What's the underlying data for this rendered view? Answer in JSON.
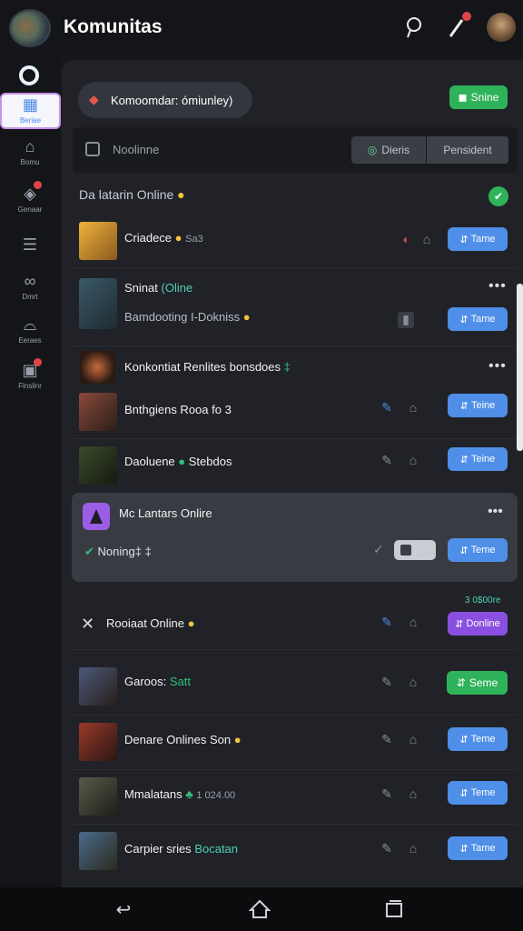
{
  "header": {
    "title": "Komunitas"
  },
  "sidebar": {
    "items": [
      {
        "label": "Beriae"
      },
      {
        "label": "Bomu"
      },
      {
        "label": "Genaar"
      },
      {
        "label": ""
      },
      {
        "label": "Dmrt"
      },
      {
        "label": "Eeraes"
      },
      {
        "label": "Finslinr"
      }
    ]
  },
  "top": {
    "pill_label": "Komoomdar: ómiunley)",
    "green_button": "Snine"
  },
  "search": {
    "placeholder": "Noolinne",
    "seg_left": "Dieris",
    "seg_right": "Pensident"
  },
  "section": {
    "title": "Da latarin Online"
  },
  "rows": [
    {
      "name": "Criadece",
      "extra": "Sa3",
      "button": "Tame"
    },
    {
      "name": "Sninat",
      "status": "(Oline",
      "sub": "Bamdooting I-Dokniss",
      "button": "Tame"
    },
    {
      "name": "Konkontiat Renlites bonsdoes",
      "extra": "‡"
    },
    {
      "name": "Bnthgiens Rooa fo 3",
      "button": "Teine"
    },
    {
      "name": "Daoluene",
      "extra": "Stebdos",
      "button": "Teine"
    },
    {
      "name": "Mc Lantars Onlire",
      "sub": "Noning‡ ‡",
      "button": "Teme"
    },
    {
      "name": "Rooiaat Online",
      "button": "Donline",
      "tag": "3 0$00re"
    },
    {
      "name": "Garoos:",
      "status": "Satt",
      "button": "Seme"
    },
    {
      "name": "Denare Onlines Son",
      "button": "Teme"
    },
    {
      "name": "Mmalatans",
      "extra": "1 024.00",
      "button": "Teme"
    },
    {
      "name": "Carpier sries",
      "status": "Bocatan",
      "button": "Tame"
    }
  ]
}
